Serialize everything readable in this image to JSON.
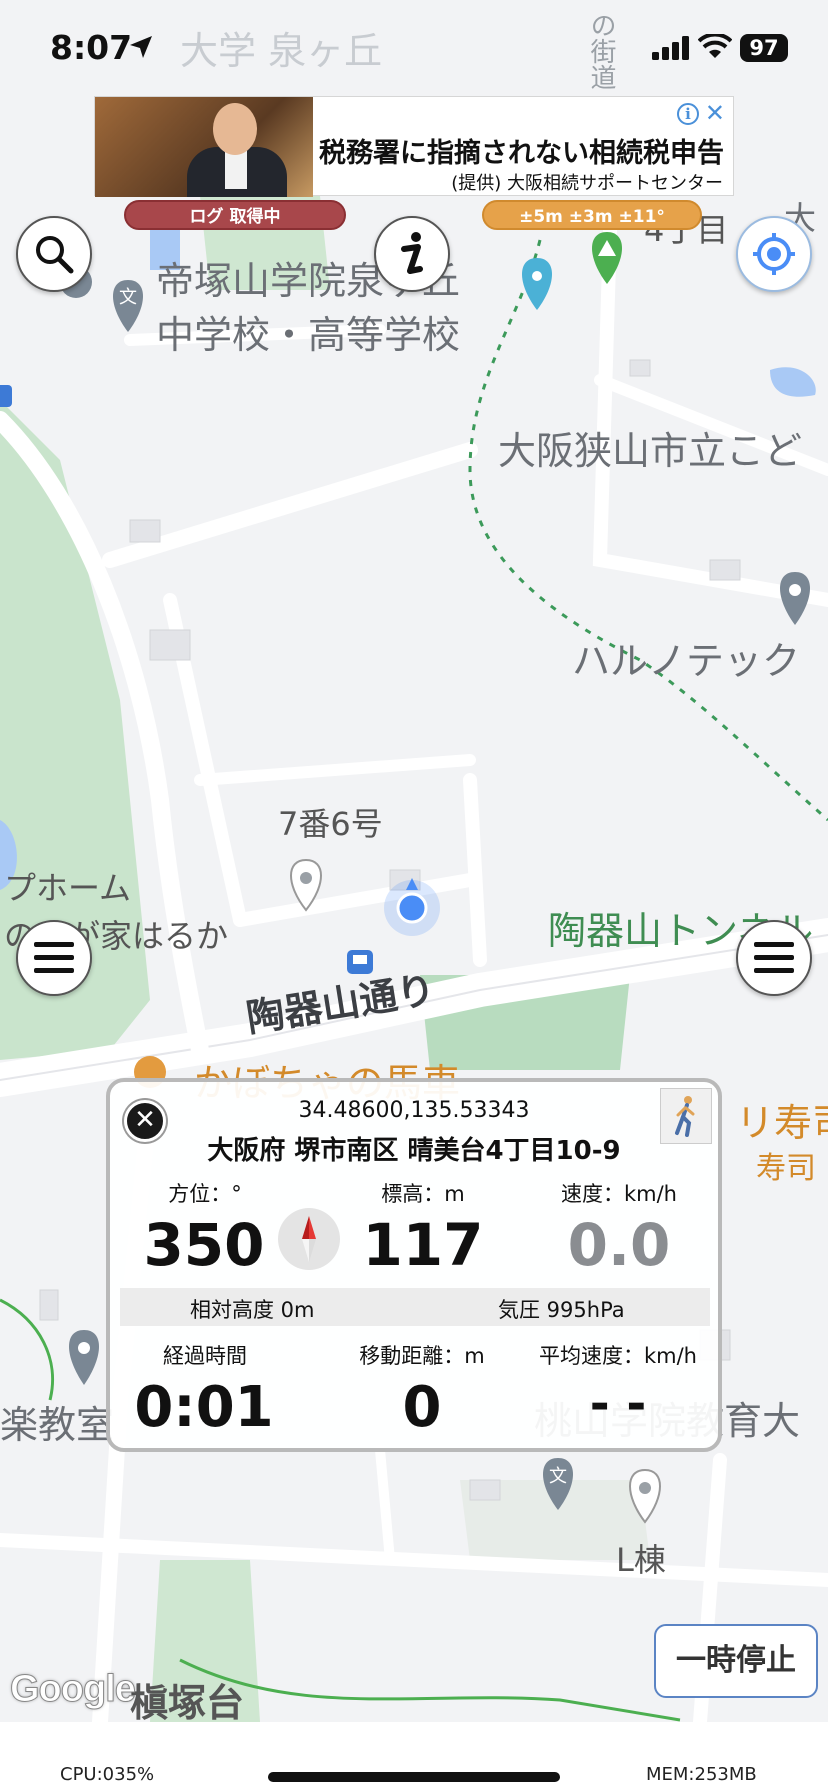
{
  "status_bar": {
    "time": "8:07",
    "battery": "97"
  },
  "ad": {
    "headline": "税務署に指摘されない相続税申告",
    "sponsor": "(提供) 大阪相続サポートセンター"
  },
  "indicators": {
    "log_status": "ログ 取得中",
    "accuracy": "±5m ±3m ±11°"
  },
  "map": {
    "labels": {
      "school_top": "大学 泉ヶ丘",
      "school_1": "帝塚山学院泉ヶ丘",
      "school_2": "中学校・高等学校",
      "kaido": "の街道",
      "chome": "4丁目",
      "top_right": "大",
      "osakasayama": "大阪狭山市立こど",
      "harunotec": "ハルノテック",
      "banchi": "7番6号",
      "home_1": "プホーム",
      "home_2": "の　が家はるか",
      "tunnel": "陶器山トンネル",
      "toukiyama_road": "陶器山通り",
      "kabocha": "かぼちゃの馬車",
      "sushi": "イ　リ寿司",
      "sushi_sub": "寿司",
      "classroom": "楽教室",
      "momoyama": "桃山学院教育大",
      "l_building": "L棟",
      "makizukadai": "槇塚台"
    }
  },
  "panel": {
    "coords": "34.48600,135.53343",
    "address": "大阪府 堺市南区 晴美台4丁目10-9",
    "heading_label": "方位：°",
    "heading_value": "350",
    "altitude_label": "標高：m",
    "altitude_value": "117",
    "speed_label": "速度：km/h",
    "speed_value": "0.0",
    "relative_altitude": "相対高度 0m",
    "pressure": "気圧 995hPa",
    "elapsed_label": "経過時間",
    "elapsed_value": "0:01",
    "distance_label": "移動距離：m",
    "distance_value": "0",
    "avg_speed_label": "平均速度：km/h",
    "avg_speed_value": "- -"
  },
  "pause_button": "一時停止",
  "footer": {
    "cpu": "CPU:035%",
    "mem": "MEM:253MB",
    "google": "Google"
  },
  "colors": {
    "accent_blue": "#4a90d9",
    "log_red": "#a8474b",
    "accuracy_orange": "#e6a24a"
  },
  "icons": [
    "location-arrow-icon",
    "signal-icon",
    "wifi-icon",
    "battery-icon",
    "search-icon",
    "info-icon",
    "target-icon",
    "menu-icon",
    "close-icon",
    "compass-icon",
    "walking-icon",
    "map-pin-icon",
    "bus-stop-icon",
    "school-icon",
    "park-icon"
  ]
}
